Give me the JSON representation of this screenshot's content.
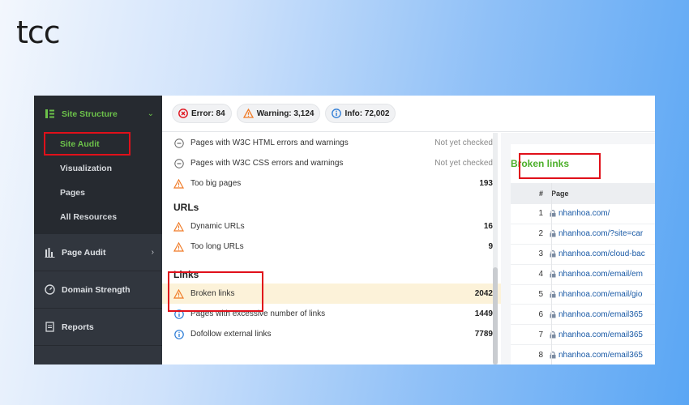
{
  "logo": "tcc",
  "sidebar": {
    "sections": [
      {
        "label": "Site Structure",
        "icon": "site-structure-icon",
        "active": true,
        "items": [
          {
            "label": "Site Audit",
            "selected": true
          },
          {
            "label": "Visualization"
          },
          {
            "label": "Pages"
          },
          {
            "label": "All Resources"
          }
        ]
      },
      {
        "label": "Page Audit",
        "icon": "page-audit-icon"
      },
      {
        "label": "Domain Strength",
        "icon": "gauge-icon"
      },
      {
        "label": "Reports",
        "icon": "report-icon"
      }
    ]
  },
  "topbar": {
    "error": "Error: 84",
    "warning": "Warning: 3,124",
    "info": "Info: 72,002"
  },
  "list": {
    "rows_top": [
      {
        "icon": "minus-circle-icon",
        "label": "Pages with W3C HTML errors and warnings",
        "value": "Not yet checked"
      },
      {
        "icon": "minus-circle-icon",
        "label": "Pages with W3C CSS errors and warnings",
        "value": "Not yet checked"
      },
      {
        "icon": "warning-icon",
        "label": "Too big pages",
        "value": "193"
      }
    ],
    "urls_title": "URLs",
    "urls_rows": [
      {
        "icon": "warning-icon",
        "label": "Dynamic URLs",
        "value": "16"
      },
      {
        "icon": "warning-icon",
        "label": "Too long URLs",
        "value": "9"
      }
    ],
    "links_title": "Links",
    "links_rows": [
      {
        "icon": "warning-icon",
        "label": "Broken links",
        "value": "2042"
      },
      {
        "icon": "info-icon",
        "label": "Pages with excessive number of links",
        "value": "1449"
      },
      {
        "icon": "info-icon",
        "label": "Dofollow external links",
        "value": "7789"
      }
    ]
  },
  "right_panel": {
    "title": "Broken links",
    "col_num": "#",
    "col_page": "Page",
    "rows": [
      {
        "num": "1",
        "page": "nhanhoa.com/"
      },
      {
        "num": "2",
        "page": "nhanhoa.com/?site=car"
      },
      {
        "num": "3",
        "page": "nhanhoa.com/cloud-bac"
      },
      {
        "num": "4",
        "page": "nhanhoa.com/email/em"
      },
      {
        "num": "5",
        "page": "nhanhoa.com/email/gio"
      },
      {
        "num": "6",
        "page": "nhanhoa.com/email365"
      },
      {
        "num": "7",
        "page": "nhanhoa.com/email365"
      },
      {
        "num": "8",
        "page": "nhanhoa.com/email365"
      }
    ]
  },
  "colors": {
    "sidebar_bg": "#31363e",
    "accent_green": "#6cc24a",
    "error_red": "#e0101a",
    "warning_orange": "#f07b27",
    "info_blue": "#2b7bd6",
    "link_blue": "#1a5aa6",
    "highlight_row": "#fcf2d9"
  }
}
